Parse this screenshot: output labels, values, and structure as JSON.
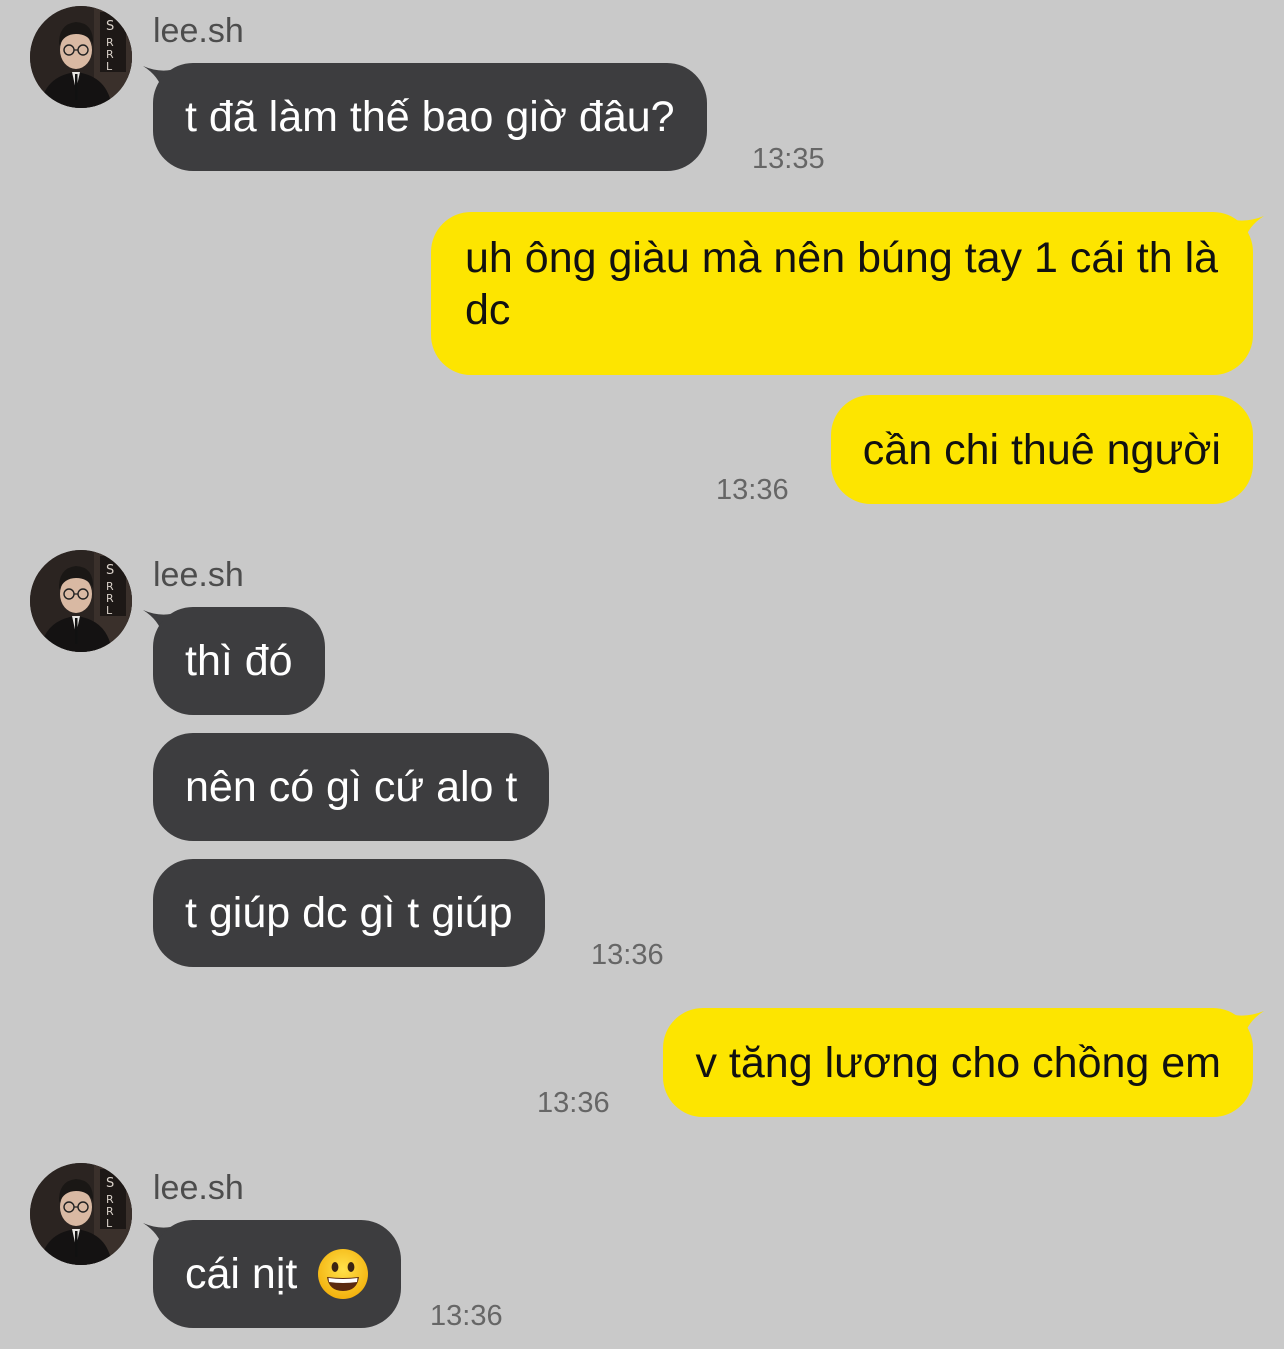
{
  "colors": {
    "background": "#c9c9c9",
    "incoming_bubble": "#3d3d3f",
    "outgoing_bubble": "#fde500",
    "timestamp": "#666666"
  },
  "groups": [
    {
      "sender": "lee.sh",
      "messages": [
        "t đã làm thế bao giờ đâu?"
      ],
      "time": "13:35"
    },
    {
      "outgoing": true,
      "messages": [
        "uh ông giàu mà nên búng tay 1 cái th là dc",
        "cần chi thuê người"
      ],
      "time": "13:36"
    },
    {
      "sender": "lee.sh",
      "messages": [
        "thì đó",
        "nên có gì cứ alo t",
        "t giúp dc gì t giúp"
      ],
      "time": "13:36"
    },
    {
      "outgoing": true,
      "messages": [
        "v tăng lương cho chồng em"
      ],
      "time": "13:36"
    },
    {
      "sender": "lee.sh",
      "messages": [
        "cái nịt"
      ],
      "emoji": "grinning-face-emoji",
      "time": "13:36"
    }
  ]
}
